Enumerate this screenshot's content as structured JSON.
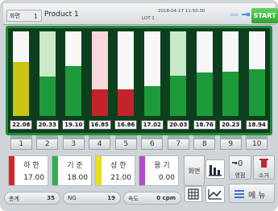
{
  "header": {
    "screen_label": "화면",
    "screen_number": "1",
    "product": "Product 1",
    "datetime": "2018-04-17 11:50:30",
    "lot": "LOT 1",
    "sub": "OLD",
    "start_label": "START"
  },
  "colors": {
    "yellow_bar": "#c9c418",
    "green_bar": "#1d9a3a",
    "red_bar": "#c3232a",
    "green_bg": "#c8eac8",
    "pink_bg": "#f8d8db",
    "white_bg": "#f7f7f7",
    "start": "#2fa52f"
  },
  "bars": [
    {
      "value": "22.08",
      "fill": 0.64,
      "bar": "#c9c418",
      "bg": "#f7f7f7"
    },
    {
      "value": "20.33",
      "fill": 0.47,
      "bar": "#1d9a3a",
      "bg": "#c8eac8"
    },
    {
      "value": "19.10",
      "fill": 0.59,
      "bar": "#1d9a3a",
      "bg": "#f7f7f7"
    },
    {
      "value": "16.85",
      "fill": 0.31,
      "bar": "#c3232a",
      "bg": "#f8d8db"
    },
    {
      "value": "16.86",
      "fill": 0.31,
      "bar": "#c3232a",
      "bg": "#f7f7f7"
    },
    {
      "value": "17.02",
      "fill": 0.35,
      "bar": "#1d9a3a",
      "bg": "#f7f7f7"
    },
    {
      "value": "20.03",
      "fill": 0.48,
      "bar": "#1d9a3a",
      "bg": "#c8eac8"
    },
    {
      "value": "18.76",
      "fill": 0.51,
      "bar": "#1d9a3a",
      "bg": "#f7f7f7"
    },
    {
      "value": "20.23",
      "fill": 0.52,
      "bar": "#1d9a3a",
      "bg": "#f7f7f7"
    },
    {
      "value": "18.94",
      "fill": 0.55,
      "bar": "#1d9a3a",
      "bg": "#f7f7f7"
    }
  ],
  "numbers": [
    "1",
    "2",
    "3",
    "4",
    "5",
    "6",
    "7",
    "8",
    "9",
    "10"
  ],
  "limits": [
    {
      "label": "하 한",
      "value": "17.00",
      "stripe": "#d9242b"
    },
    {
      "label": "기 준",
      "value": "18.00",
      "stripe": "#2bb24c"
    },
    {
      "label": "상 한",
      "value": "21.00",
      "stripe": "#e6e01c"
    },
    {
      "label": "용 기",
      "value": "0.00",
      "stripe": "#b04fc6"
    }
  ],
  "side": {
    "screen_label": "화면",
    "zero_label": "영점",
    "cancel_label": "소거",
    "menu_label": "메 뉴"
  },
  "status": {
    "total_label": "총계",
    "total_value": "35",
    "ng_label": "NG",
    "ng_value": "19",
    "speed_label": "속도",
    "speed_value": "0 cpm"
  }
}
